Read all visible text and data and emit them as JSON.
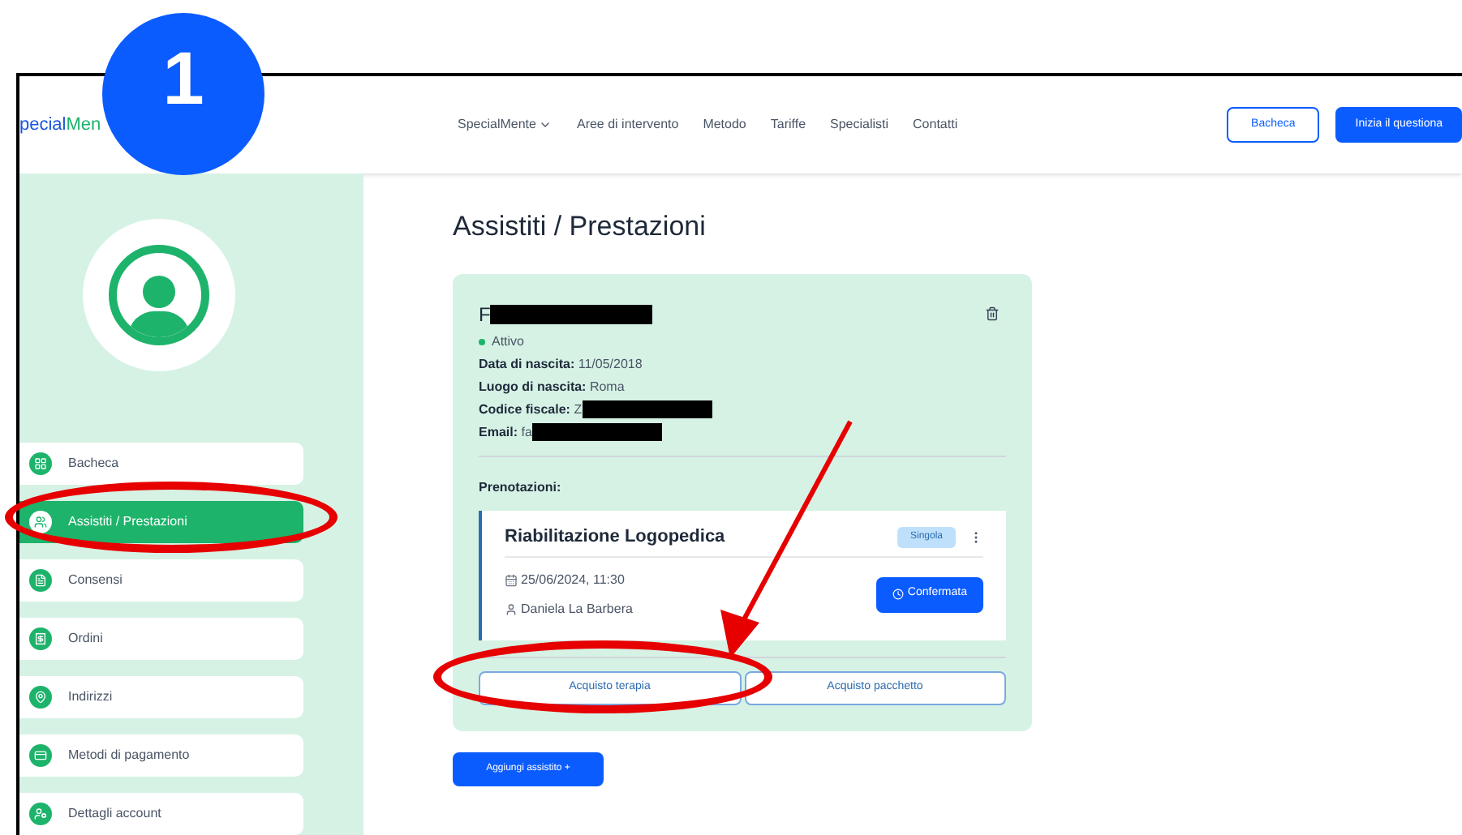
{
  "step_badge": "1",
  "header": {
    "logo": {
      "part_1": "pecial",
      "part_2": "Men"
    },
    "nav": [
      {
        "label": "SpecialMente",
        "kind": "dropdown"
      },
      {
        "label": "Aree di intervento",
        "kind": "link"
      },
      {
        "label": "Metodo",
        "kind": "link"
      },
      {
        "label": "Tariffe",
        "kind": "link"
      },
      {
        "label": "Specialisti",
        "kind": "link"
      },
      {
        "label": "Contatti",
        "kind": "link"
      }
    ],
    "buttons": [
      {
        "label": "Bacheca",
        "kind": "outline"
      },
      {
        "label": "Inizia il questiona",
        "kind": "solid"
      }
    ]
  },
  "sidebar": {
    "items": [
      {
        "label": "Bacheca",
        "selected": false
      },
      {
        "label": "Assistiti / Prestazioni",
        "selected": true
      },
      {
        "label": "Consensi",
        "selected": false
      },
      {
        "label": "Ordini",
        "selected": false
      },
      {
        "label": "Indirizzi",
        "selected": false
      },
      {
        "label": "Metodi di pagamento",
        "selected": false
      },
      {
        "label": "Dettagli account",
        "selected": false
      }
    ]
  },
  "main": {
    "title": "Assistiti / Prestazioni",
    "patient": {
      "name": "F",
      "status": {
        "label": "Attivo",
        "color": "#1db36b"
      },
      "details": [
        {
          "text": "**Data di nascita:** 11/05/2018",
          "redacted": false
        },
        {
          "text": "**Luogo di nascita:** Roma",
          "redacted": false
        },
        {
          "text": "**Codice fiscale:** Z",
          "redacted": true
        },
        {
          "text": "**Email:** fa",
          "redacted": true
        }
      ],
      "bookings_label": "Prenotazioni:",
      "booking": {
        "title": "Riabilitazione Logopedica",
        "tag": "Singola",
        "datetime": "25/06/2024, 11:30",
        "specialist": "Daniela La Barbera",
        "status_button": "Confermata"
      },
      "actions": [
        "Acquisto terapia",
        "Acquisto pacchetto"
      ]
    },
    "add_button": "Aggiungi assistito +"
  }
}
